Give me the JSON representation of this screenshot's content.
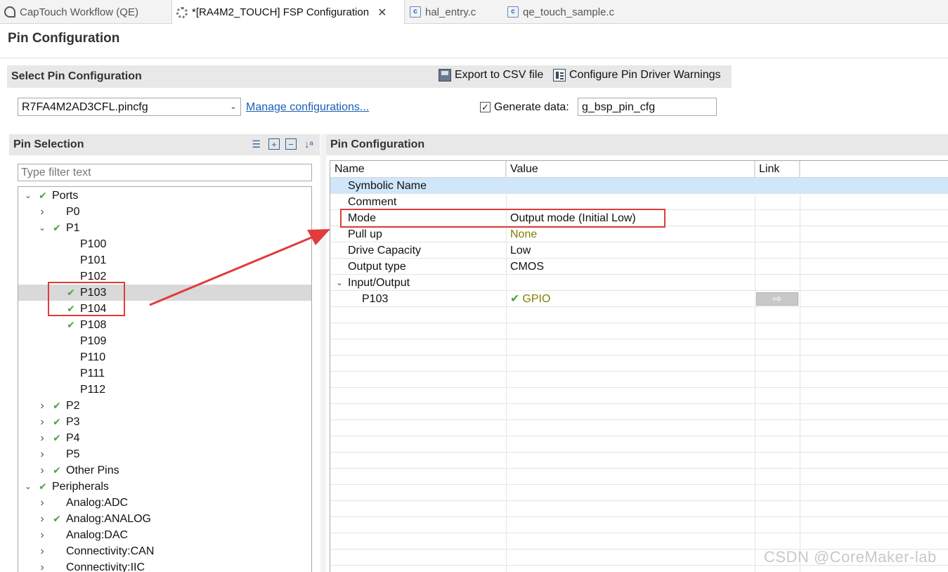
{
  "tabs": [
    {
      "label": "CapTouch Workflow (QE)",
      "icon": "captouch-icon"
    },
    {
      "label": "*[RA4M2_TOUCH] FSP Configuration",
      "icon": "gear-icon",
      "active": true
    },
    {
      "label": "hal_entry.c",
      "icon": "c-file-icon"
    },
    {
      "label": "qe_touch_sample.c",
      "icon": "c-file-icon"
    }
  ],
  "page_title": "Pin Configuration",
  "select_bar": {
    "label": "Select Pin Configuration",
    "export_label": "Export to CSV file",
    "warnings_label": "Configure Pin Driver Warnings"
  },
  "config": {
    "selected_file": "R7FA4M2AD3CFL.pincfg",
    "manage_link": "Manage configurations...",
    "generate_label": "Generate data:",
    "generate_value": "g_bsp_pin_cfg"
  },
  "pin_selection": {
    "title": "Pin Selection",
    "filter_placeholder": "Type filter text",
    "tree": [
      {
        "label": "Ports",
        "twisty": "open",
        "check": true,
        "level": 0
      },
      {
        "label": "P0",
        "twisty": "closed",
        "check": false,
        "level": 1
      },
      {
        "label": "P1",
        "twisty": "open",
        "check": true,
        "level": 1
      },
      {
        "label": "P100",
        "twisty": "none",
        "check": false,
        "level": 2
      },
      {
        "label": "P101",
        "twisty": "none",
        "check": false,
        "level": 2
      },
      {
        "label": "P102",
        "twisty": "none",
        "check": false,
        "level": 2
      },
      {
        "label": "P103",
        "twisty": "none",
        "check": true,
        "level": 2,
        "selected": true
      },
      {
        "label": "P104",
        "twisty": "none",
        "check": true,
        "level": 2
      },
      {
        "label": "P108",
        "twisty": "none",
        "check": true,
        "level": 2
      },
      {
        "label": "P109",
        "twisty": "none",
        "check": false,
        "level": 2
      },
      {
        "label": "P110",
        "twisty": "none",
        "check": false,
        "level": 2
      },
      {
        "label": "P111",
        "twisty": "none",
        "check": false,
        "level": 2
      },
      {
        "label": "P112",
        "twisty": "none",
        "check": false,
        "level": 2
      },
      {
        "label": "P2",
        "twisty": "closed",
        "check": true,
        "level": 1
      },
      {
        "label": "P3",
        "twisty": "closed",
        "check": true,
        "level": 1
      },
      {
        "label": "P4",
        "twisty": "closed",
        "check": true,
        "level": 1
      },
      {
        "label": "P5",
        "twisty": "closed",
        "check": false,
        "level": 1
      },
      {
        "label": "Other Pins",
        "twisty": "closed",
        "check": true,
        "level": 1
      },
      {
        "label": "Peripherals",
        "twisty": "open",
        "check": true,
        "level": 0
      },
      {
        "label": "Analog:ADC",
        "twisty": "closed",
        "check": false,
        "level": 1
      },
      {
        "label": "Analog:ANALOG",
        "twisty": "closed",
        "check": true,
        "level": 1
      },
      {
        "label": "Analog:DAC",
        "twisty": "closed",
        "check": false,
        "level": 1
      },
      {
        "label": "Connectivity:CAN",
        "twisty": "closed",
        "check": false,
        "level": 1
      },
      {
        "label": "Connectivity:IIC",
        "twisty": "closed",
        "check": false,
        "level": 1
      }
    ]
  },
  "pin_config": {
    "title": "Pin Configuration",
    "columns": [
      "Name",
      "Value",
      "Link"
    ],
    "rows": [
      {
        "name": "Symbolic Name",
        "value": "",
        "indent": 1,
        "highlight": true
      },
      {
        "name": "Comment",
        "value": "",
        "indent": 1
      },
      {
        "name": "Mode",
        "value": "Output mode (Initial Low)",
        "indent": 1
      },
      {
        "name": "Pull up",
        "value": "None",
        "indent": 1,
        "value_color": "#808000"
      },
      {
        "name": "Drive Capacity",
        "value": "Low",
        "indent": 1
      },
      {
        "name": "Output type",
        "value": "CMOS",
        "indent": 1
      },
      {
        "name": "Input/Output",
        "value": "",
        "indent": 0,
        "twisty": "open"
      },
      {
        "name": "P103",
        "value": "GPIO",
        "indent": 2,
        "value_color": "#808000",
        "value_check": true,
        "link_button": true
      }
    ]
  },
  "annotation_color": "#e23b3b",
  "watermark": "CSDN @CoreMaker-lab"
}
